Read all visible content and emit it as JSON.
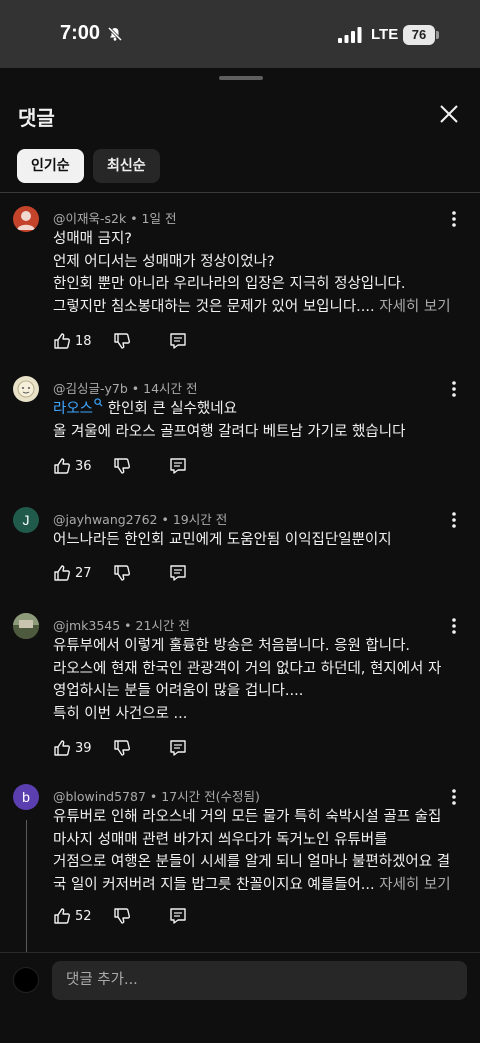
{
  "status": {
    "time": "7:00",
    "network": "LTE",
    "battery": "76"
  },
  "sheet": {
    "title": "댓글",
    "sort_chips": [
      {
        "label": "인기순"
      },
      {
        "label": "최신순"
      }
    ]
  },
  "comments": [
    {
      "author": "@이재욱-s2k",
      "time": "1일 전",
      "lines": [
        "성매매 금지?",
        "언제 어디서는 성매매가 정상이었나?",
        "한인회 뿐만 아니라 우리나라의 입장은 지극히 정상입니다.",
        "그렇지만 침소봉대하는 것은 문제가 있어 보입니다...."
      ],
      "more": "자세히 보기",
      "likes": "18",
      "avatar_color": "#c4432b"
    },
    {
      "author": "@김싱글-y7b",
      "time": "14시간 전",
      "mention": "라오스",
      "lines": [
        " 한인회 큰 실수했네요",
        "올 겨울에 라오스 골프여행 갈려다 베트남 가기로 했습니다"
      ],
      "likes": "36",
      "avatar_color": "#e8e2c8"
    },
    {
      "author": "@jayhwang2762",
      "time": "19시간 전",
      "lines": [
        "어느나라든 한인회 교민에게 도움안됨 이익집단일뿐이지"
      ],
      "likes": "27",
      "avatar_letter": "J",
      "avatar_color": "#1f5a4a"
    },
    {
      "author": "@jmk3545",
      "time": "21시간 전",
      "lines": [
        "유튜부에서 이렇게 훌륭한 방송은 처음봅니다. 응원 합니다.",
        "라오스에 현재 한국인 관광객이 거의 없다고  하던데, 현지에서 자",
        "영업하시는 분들 어려움이  많을 겁니다....",
        "특히 이번 사건으로 ..."
      ],
      "likes": "39",
      "avatar_color": "#6b7a5a"
    },
    {
      "author": "@blowind5787",
      "time": "17시간 전(수정됨)",
      "lines": [
        "유튜버로 인해 라오스네 거의 모든 물가 특히 숙박시설 골프 술집",
        "마사지 성매매 관련 바가지 씌우다가 독거노인 유튜버를",
        "거점으로 여행온 분들이 시세를 알게 되니 얼마나 불편하겠어요 결",
        "국 일이 커저버려 지들 밥그릇 찬꼴이지요 예를들어..."
      ],
      "more": "자세히 보기",
      "likes": "52",
      "avatar_letter": "b",
      "avatar_color": "#5b3fb0"
    }
  ],
  "add_comment": {
    "placeholder": "댓글 추가..."
  }
}
